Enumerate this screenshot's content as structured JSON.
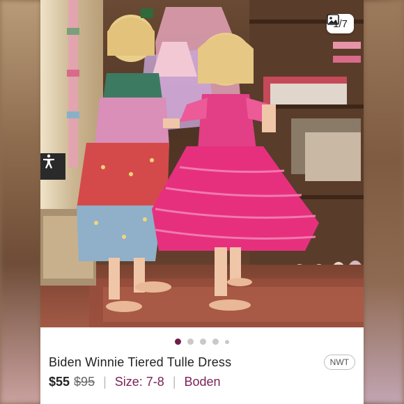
{
  "gallery": {
    "counter": "1/7",
    "image_alt": "Two children in tulle dresses by a shelf",
    "dots_total": 5,
    "dots_active": 1
  },
  "listing": {
    "title": "Biden Winnie Tiered Tulle Dress",
    "condition_badge": "NWT",
    "price": "$55",
    "original_price": "$95",
    "size_label": "Size: 7-8",
    "brand": "Boden",
    "separator": "|"
  },
  "colors": {
    "accent": "#7b2257",
    "active_dot": "#6d1f4a"
  },
  "icons": {
    "gallery": "image-icon",
    "accessibility": "accessibility-icon"
  }
}
